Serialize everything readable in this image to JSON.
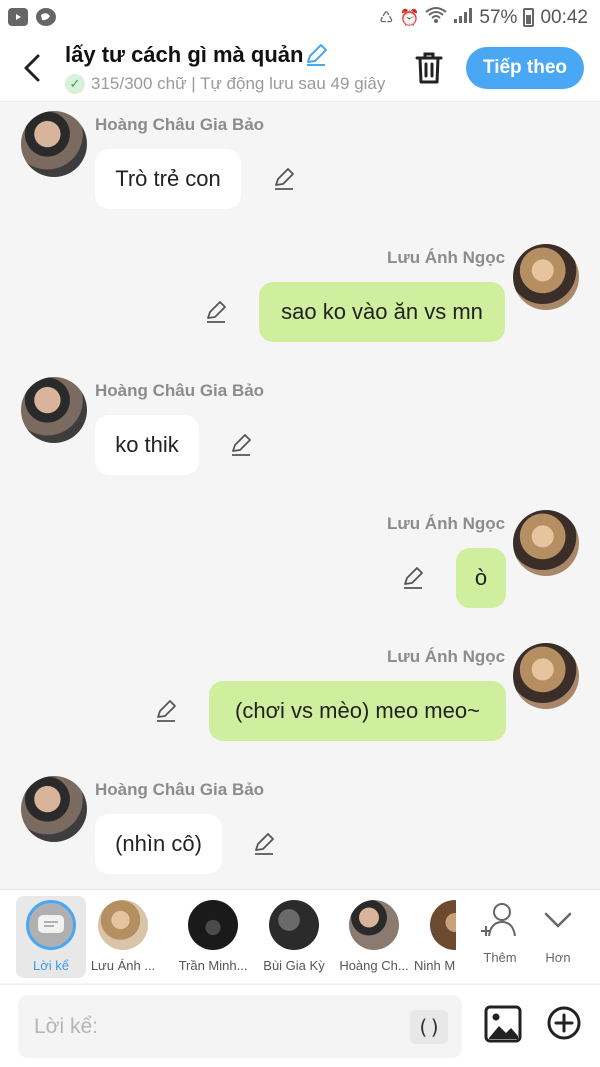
{
  "status_bar": {
    "battery": "57%",
    "time": "00:42"
  },
  "header": {
    "title": "lấy tư cách gì mà quản",
    "meta": "315/300 chữ | Tự động lưu sau 49 giây",
    "next_label": "Tiếp theo"
  },
  "messages": [
    {
      "side": "in",
      "sender": "Hoàng Châu Gia Bảo",
      "text": "Trò trẻ con"
    },
    {
      "side": "out",
      "sender": "Lưu Ánh Ngọc",
      "text": "sao ko vào ăn vs mn"
    },
    {
      "side": "in",
      "sender": "Hoàng Châu Gia Bảo",
      "text": "ko thik"
    },
    {
      "side": "out",
      "sender": "Lưu Ánh Ngọc",
      "text": "ò"
    },
    {
      "side": "out",
      "sender": "Lưu Ánh Ngọc",
      "text": "(chơi vs mèo) meo meo~"
    },
    {
      "side": "in",
      "sender": "Hoàng Châu Gia Bảo",
      "text": "(nhìn cô)"
    }
  ],
  "character_bar": {
    "narrator_label": "Lời kể",
    "characters": [
      {
        "label": "Lưu Ánh ..."
      },
      {
        "label": "Trần Minh..."
      },
      {
        "label": "Bùi Gia Kỳ"
      },
      {
        "label": "Hoàng Ch..."
      },
      {
        "label": "Ninh M"
      }
    ],
    "add_label": "Thêm",
    "more_label": "Hơn"
  },
  "input": {
    "placeholder": "Lời kể:",
    "paren_label": "()"
  }
}
